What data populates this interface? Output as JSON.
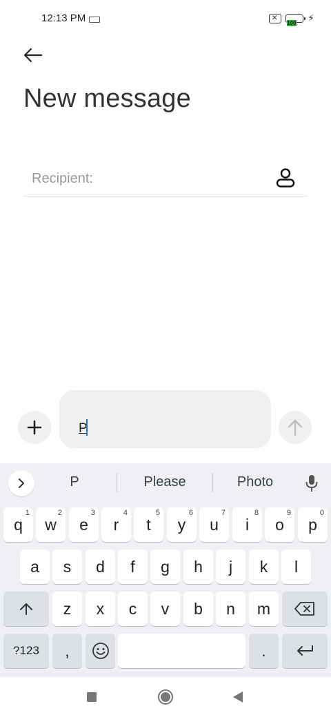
{
  "status_bar": {
    "time": "12:13 PM",
    "battery_level": "100",
    "icons": [
      "keyboard-icon",
      "no-sim-icon",
      "battery-icon",
      "charging-bolt-icon"
    ]
  },
  "header": {
    "title": "New message",
    "back_icon": "back-arrow-icon"
  },
  "recipient": {
    "placeholder": "Recipient:",
    "value": "",
    "contact_icon": "contact-person-icon"
  },
  "compose": {
    "text": "P",
    "add_icon": "plus-icon",
    "send_icon": "send-arrow-icon"
  },
  "keyboard": {
    "suggestions": [
      "P",
      "Please",
      "Photo"
    ],
    "row1": [
      {
        "label": "q",
        "hint": "1"
      },
      {
        "label": "w",
        "hint": "2"
      },
      {
        "label": "e",
        "hint": "3"
      },
      {
        "label": "r",
        "hint": "4"
      },
      {
        "label": "t",
        "hint": "5"
      },
      {
        "label": "y",
        "hint": "6"
      },
      {
        "label": "u",
        "hint": "7"
      },
      {
        "label": "i",
        "hint": "8"
      },
      {
        "label": "o",
        "hint": "9"
      },
      {
        "label": "p",
        "hint": "0"
      }
    ],
    "row2": [
      "a",
      "s",
      "d",
      "f",
      "g",
      "h",
      "j",
      "k",
      "l"
    ],
    "row3": [
      "z",
      "x",
      "c",
      "v",
      "b",
      "n",
      "m"
    ],
    "row4": {
      "symbols": "?123",
      "comma": ",",
      "period": ".",
      "space": ""
    }
  },
  "nav_bar": {
    "icons": [
      "recents-square-icon",
      "home-circle-icon",
      "back-triangle-icon"
    ]
  }
}
